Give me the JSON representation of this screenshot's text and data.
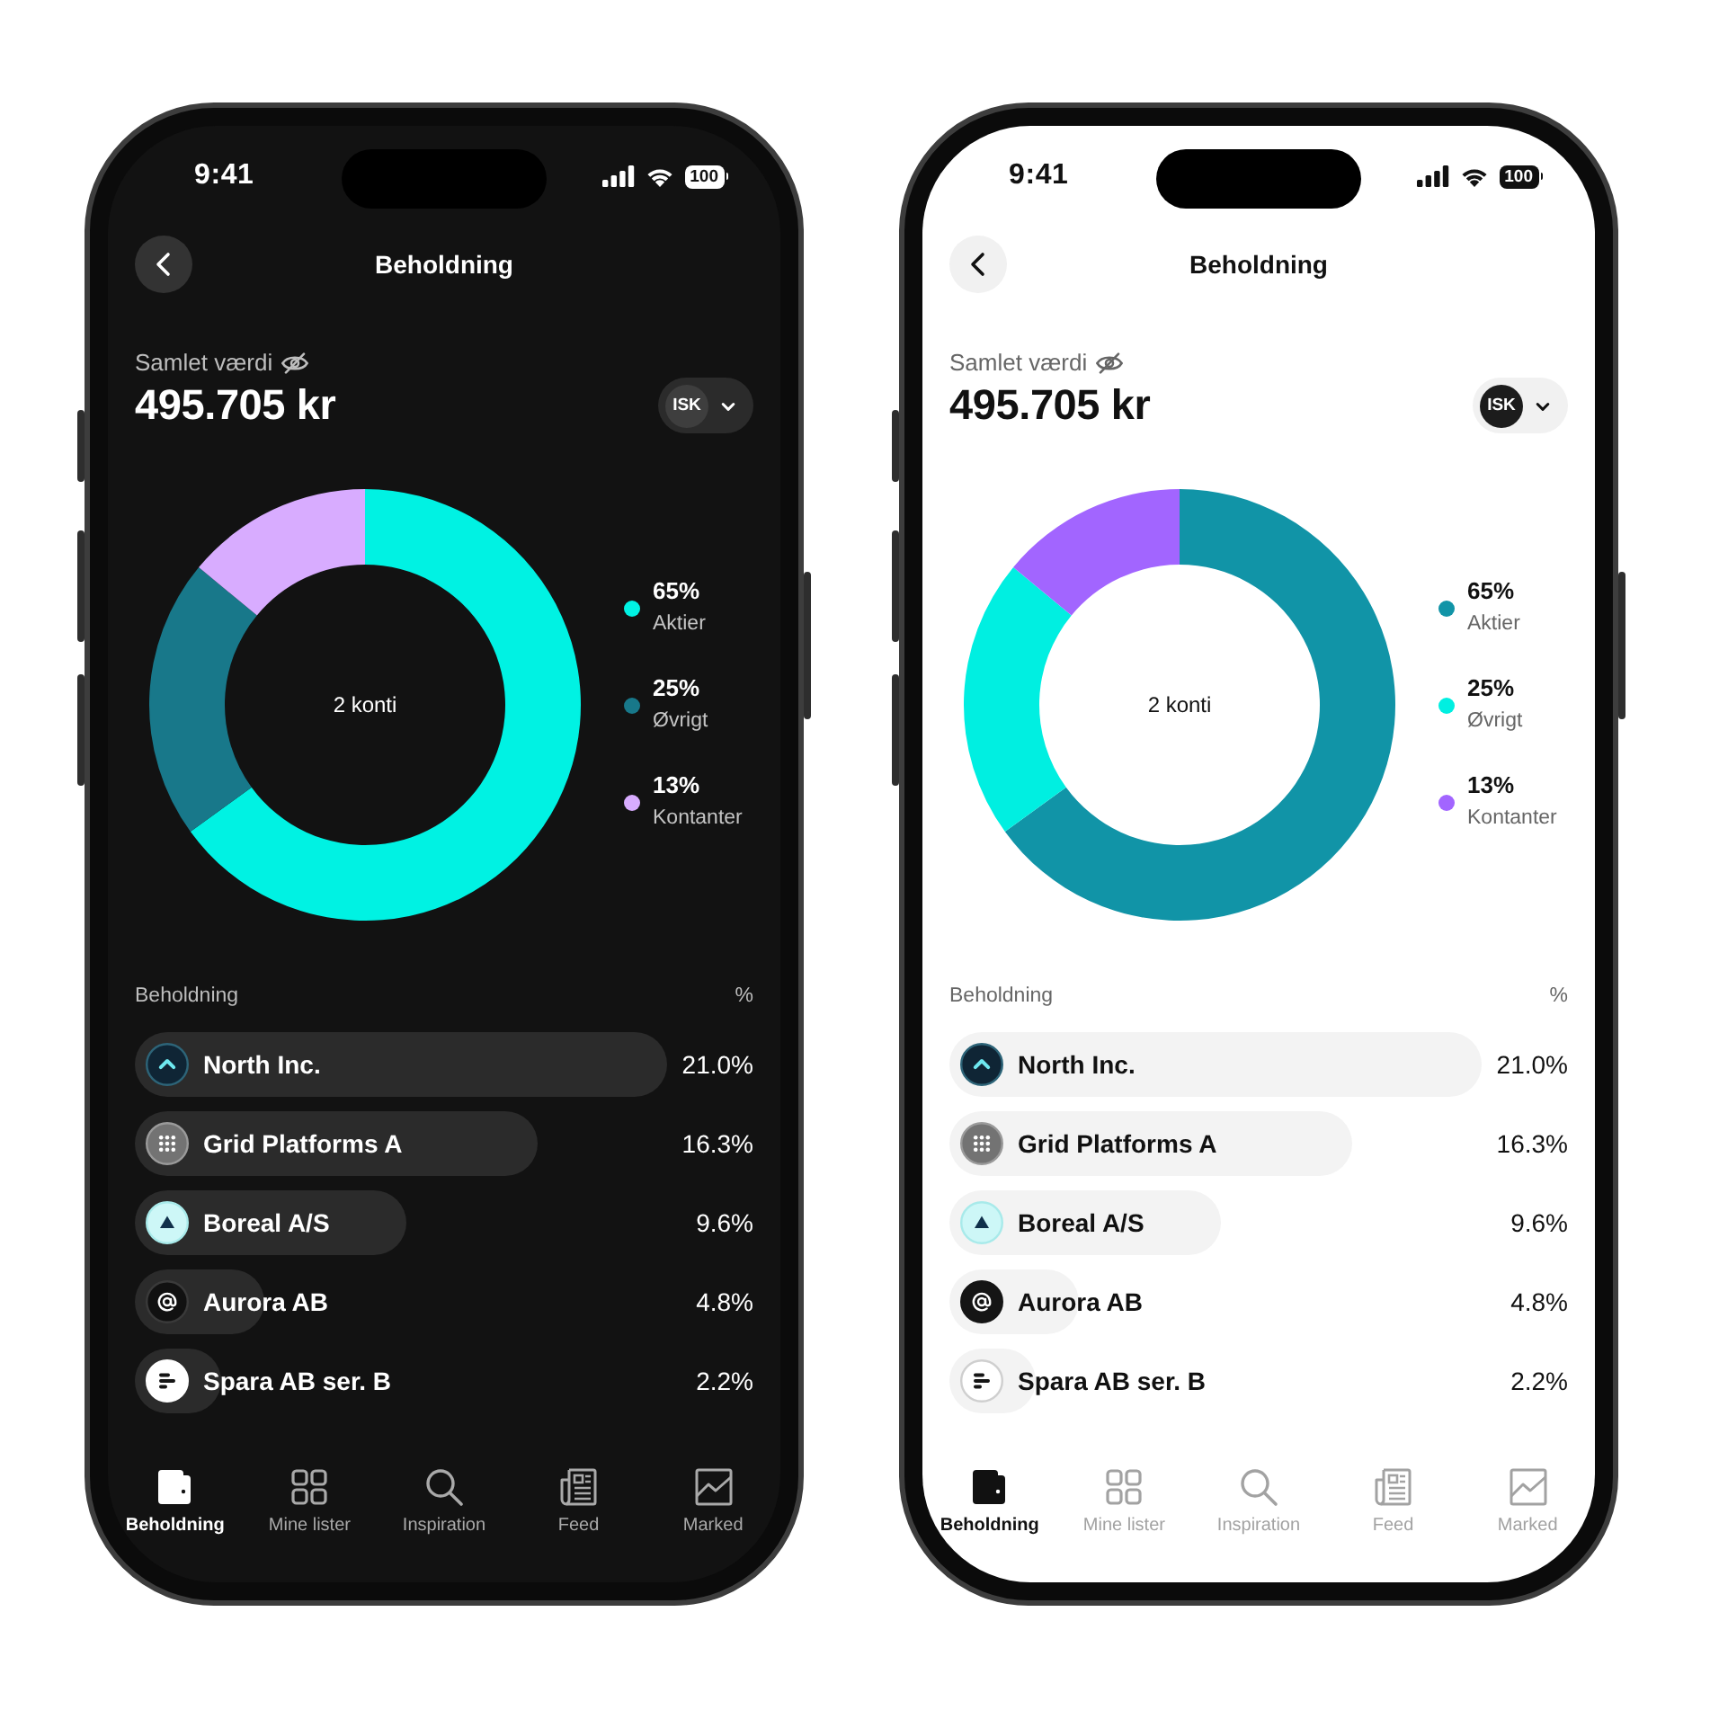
{
  "phones": [
    {
      "kind": "dark",
      "status_bar": {
        "time": "9:41",
        "battery": "100"
      },
      "header": {
        "title": "Beholdning"
      },
      "total": {
        "label": "Samlet værdi",
        "value": "495.705 kr",
        "account": "ISK"
      },
      "chart": {
        "center_label": "2 konti",
        "chart_data": {
          "type": "donut",
          "categories": [
            "Aktier",
            "Øvrigt",
            "Kontanter"
          ],
          "values": [
            65,
            21,
            14
          ]
        },
        "legend": [
          {
            "value": "65%",
            "color": "#00f2e3"
          },
          {
            "value": "25%",
            "color": "#18788a"
          },
          {
            "value": "13%",
            "color": "#d8acff"
          }
        ]
      },
      "holdings": {
        "heading": "Beholdning",
        "share_heading": "%",
        "items": [
          {
            "kind": "chevron",
            "name": "North Inc.",
            "share": "21.0%",
            "level": 0.86
          },
          {
            "kind": "grid",
            "name": "Grid Platforms A",
            "share": "16.3%",
            "level": 0.65
          },
          {
            "kind": "triangle",
            "name": "Boreal A/S",
            "share": "9.6%",
            "level": 0.44
          },
          {
            "kind": "at",
            "name": "Aurora AB",
            "share": "4.8%",
            "level": 0.21
          },
          {
            "kind": "lines",
            "name": "Spara AB ser. B",
            "share": "2.2%",
            "level": 0.14
          }
        ]
      },
      "tabs": [
        {
          "kind": "wallet",
          "label": "Beholdning",
          "selected": true
        },
        {
          "kind": "grid",
          "label": "Mine lister",
          "selected": false
        },
        {
          "kind": "search",
          "label": "Inspiration",
          "selected": false
        },
        {
          "kind": "newspaper",
          "label": "Feed",
          "selected": false
        },
        {
          "kind": "chart",
          "label": "Marked",
          "selected": false
        }
      ]
    },
    {
      "kind": "light",
      "status_bar": {
        "time": "9:41",
        "battery": "100"
      },
      "header": {
        "title": "Beholdning"
      },
      "total": {
        "label": "Samlet værdi",
        "value": "495.705 kr",
        "account": "ISK"
      },
      "chart": {
        "center_label": "2 konti",
        "chart_data": {
          "type": "donut",
          "categories": [
            "Aktier",
            "Øvrigt",
            "Kontanter"
          ],
          "values": [
            65,
            21,
            14
          ]
        },
        "legend": [
          {
            "value": "65%",
            "color": "#1194a7"
          },
          {
            "value": "25%",
            "color": "#00efe1"
          },
          {
            "value": "13%",
            "color": "#a265ff"
          }
        ]
      },
      "holdings": {
        "heading": "Beholdning",
        "share_heading": "%",
        "items": [
          {
            "kind": "chevron",
            "name": "North Inc.",
            "share": "21.0%",
            "level": 0.86
          },
          {
            "kind": "grid",
            "name": "Grid Platforms A",
            "share": "16.3%",
            "level": 0.65
          },
          {
            "kind": "triangle",
            "name": "Boreal A/S",
            "share": "9.6%",
            "level": 0.44
          },
          {
            "kind": "at",
            "name": "Aurora AB",
            "share": "4.8%",
            "level": 0.21
          },
          {
            "kind": "lines",
            "name": "Spara AB ser. B",
            "share": "2.2%",
            "level": 0.14
          }
        ]
      },
      "tabs": [
        {
          "kind": "wallet",
          "label": "Beholdning",
          "selected": true
        },
        {
          "kind": "grid",
          "label": "Mine lister",
          "selected": false
        },
        {
          "kind": "search",
          "label": "Inspiration",
          "selected": false
        },
        {
          "kind": "newspaper",
          "label": "Feed",
          "selected": false
        },
        {
          "kind": "chart",
          "label": "Marked",
          "selected": false
        }
      ]
    }
  ]
}
